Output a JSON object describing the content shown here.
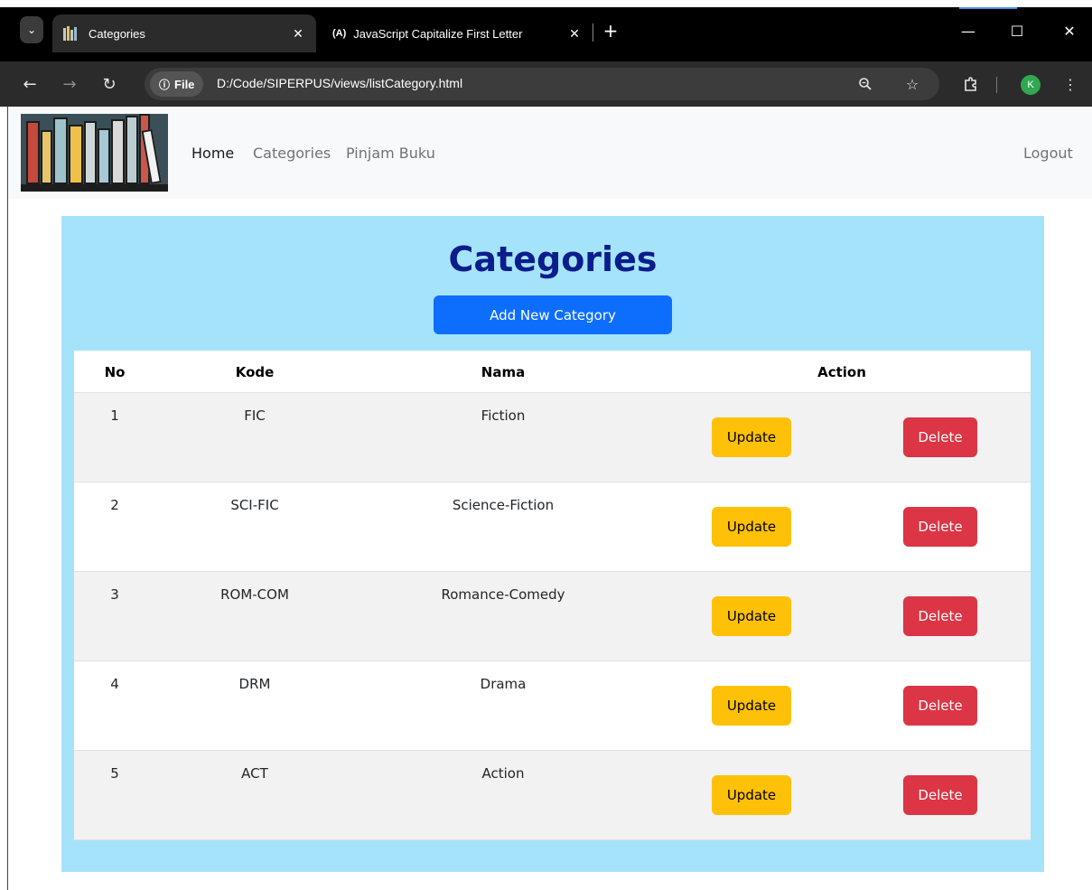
{
  "browser": {
    "tabs": [
      {
        "title": "Categories",
        "active": true
      },
      {
        "title": "JavaScript Capitalize First Letter",
        "active": false
      }
    ],
    "tab_close_glyph": "✕",
    "new_tab_glyph": "+",
    "site_chip": "File",
    "url": "D:/Code/SIPERPUS/views/listCategory.html",
    "profile_initial": "K",
    "icons": {
      "back": "arrow-left-icon",
      "forward": "arrow-right-icon",
      "reload": "reload-icon",
      "zoom": "zoom-icon",
      "bookmark": "star-icon",
      "extensions": "puzzle-icon",
      "menu": "kebab-menu-icon"
    }
  },
  "navbar": {
    "links": [
      {
        "label": "Home",
        "active": true
      },
      {
        "label": "Categories",
        "active": false
      },
      {
        "label": "Pinjam Buku",
        "active": false
      }
    ],
    "logout": "Logout"
  },
  "page": {
    "title": "Categories",
    "add_button": "Add New Category",
    "colors": {
      "panel": "#a5e3fb",
      "title": "#0b1d8c",
      "primary": "#0d6efd",
      "warning": "#ffc107",
      "danger": "#dc3545"
    }
  },
  "table": {
    "headers": [
      "No",
      "Kode",
      "Nama",
      "Action"
    ],
    "rows": [
      {
        "no": "1",
        "kode": "FIC",
        "nama": "Fiction",
        "update": "Update",
        "delete": "Delete"
      },
      {
        "no": "2",
        "kode": "SCI-FIC",
        "nama": "Science-Fiction",
        "update": "Update",
        "delete": "Delete"
      },
      {
        "no": "3",
        "kode": "ROM-COM",
        "nama": "Romance-Comedy",
        "update": "Update",
        "delete": "Delete"
      },
      {
        "no": "4",
        "kode": "DRM",
        "nama": "Drama",
        "update": "Update",
        "delete": "Delete"
      },
      {
        "no": "5",
        "kode": "ACT",
        "nama": "Action",
        "update": "Update",
        "delete": "Delete"
      }
    ]
  }
}
